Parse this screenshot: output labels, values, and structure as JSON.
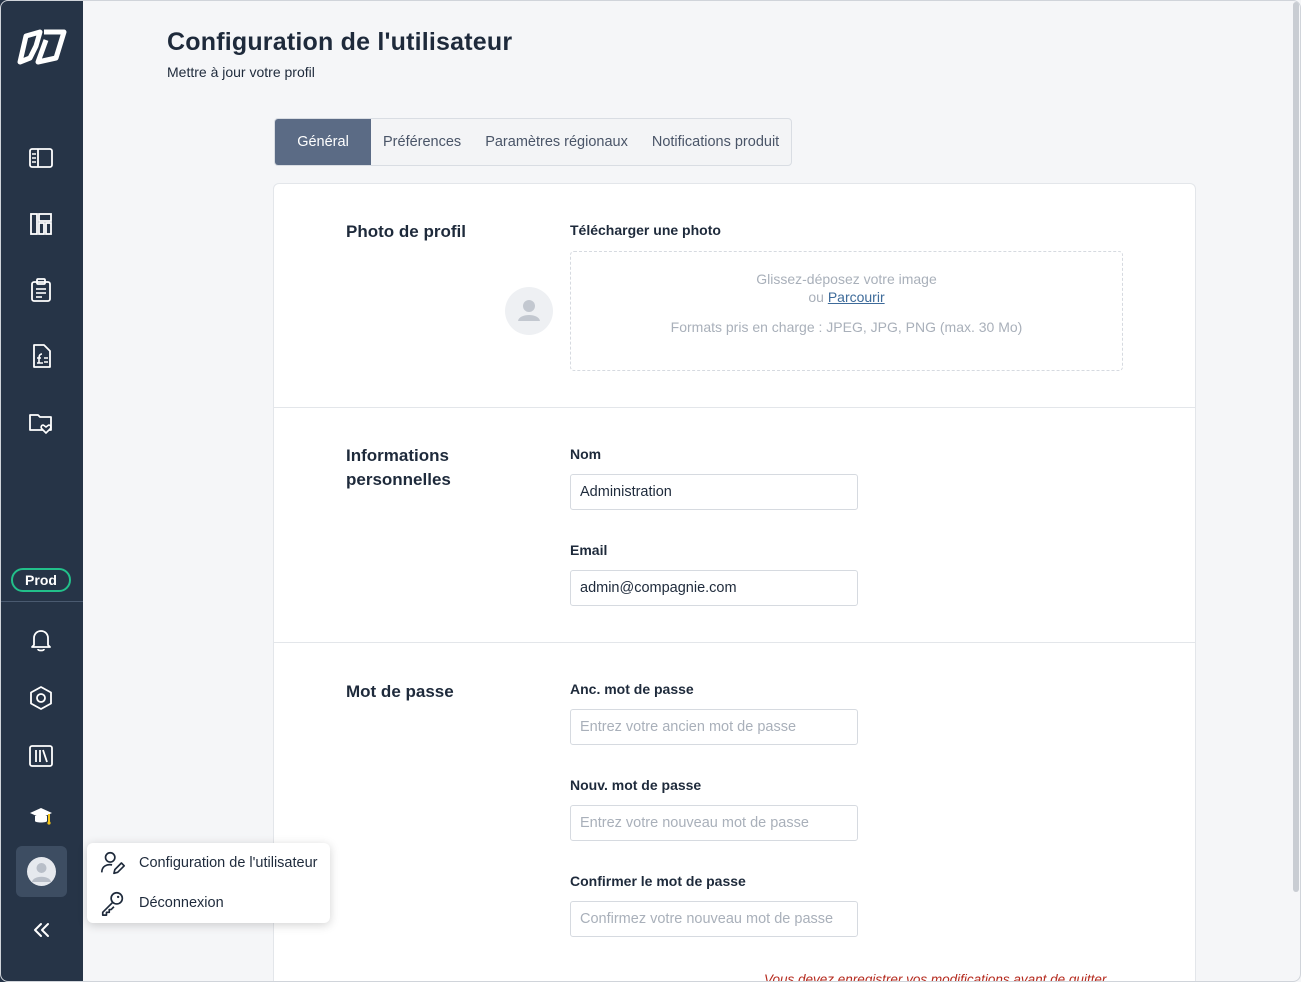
{
  "sidebar": {
    "logo": "app-logo",
    "nav_icons": [
      "sidebar-panel-icon",
      "dashboard-icon",
      "clipboard-icon",
      "invoice-icon",
      "folder-heart-icon"
    ],
    "env_badge": "Prod",
    "bottom_icons": [
      "bell-icon",
      "hexagon-settings-icon",
      "library-icon",
      "graduation-cap-icon"
    ],
    "collapse_icon": "chevrons-left-icon"
  },
  "header": {
    "title": "Configuration de l'utilisateur",
    "subtitle": "Mettre à jour votre profil"
  },
  "tabs": [
    {
      "label": "Général",
      "active": true
    },
    {
      "label": "Préférences",
      "active": false
    },
    {
      "label": "Paramètres régionaux",
      "active": false
    },
    {
      "label": "Notifications produit",
      "active": false
    }
  ],
  "profile_photo": {
    "section_title": "Photo de profil",
    "upload_label": "Télécharger une photo",
    "dropzone_text": "Glissez-déposez votre image",
    "or_text": "ou",
    "browse_link": "Parcourir",
    "formats_text": "Formats pris en charge : JPEG, JPG, PNG (max. 30 Mo)"
  },
  "personal_info": {
    "section_title": "Informations personnelles",
    "name_label": "Nom",
    "name_value": "Administration",
    "email_label": "Email",
    "email_value": "admin@compagnie.com"
  },
  "password": {
    "section_title": "Mot de passe",
    "old_label": "Anc. mot de passe",
    "old_placeholder": "Entrez votre ancien mot de passe",
    "new_label": "Nouv. mot de passe",
    "new_placeholder": "Entrez votre nouveau mot de passe",
    "confirm_label": "Confirmer le mot de passe",
    "confirm_placeholder": "Confirmez votre nouveau mot de passe"
  },
  "warning": "Vous devez enregistrer vos modifications avant de quitter",
  "user_menu": {
    "items": [
      {
        "label": "Configuration de l'utilisateur",
        "icon": "user-edit-icon"
      },
      {
        "label": "Déconnexion",
        "icon": "key-icon"
      }
    ]
  },
  "colors": {
    "sidebar_bg": "#263447",
    "tab_active_bg": "#5b6b85",
    "badge_border": "#22c08a",
    "link": "#3e6b9a",
    "warning": "#b52b1f"
  }
}
